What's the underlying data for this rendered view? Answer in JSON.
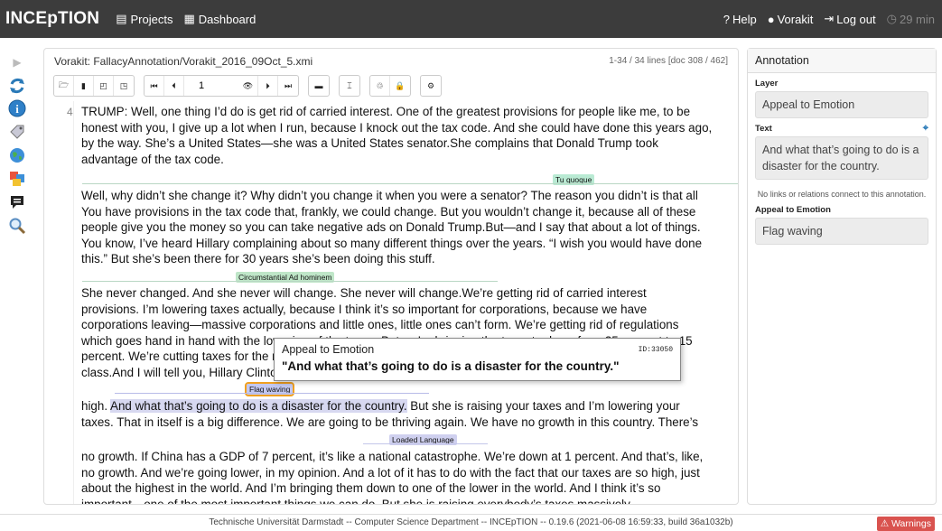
{
  "navbar": {
    "brand": "INCEpTION",
    "projects": "Projects",
    "dashboard": "Dashboard",
    "help": "Help",
    "user": "Vorakit",
    "logout": "Log out",
    "timer": "29 min"
  },
  "document": {
    "title": "Vorakit: FallacyAnnotation/Vorakit_2016_09Oct_5.xmi",
    "position": "1-34 / 34 lines [doc 308 / 462]",
    "page_value": "1",
    "line_number": "4",
    "lines": [
      "TRUMP: Well, one thing I’d do is get rid of carried interest. One of the greatest provisions for people like me, to be",
      "honest with you, I give up a lot when I run, because I knock out the tax code. And she could have done this years ago,",
      "by the way. She’s a United States—she was a United States senator.She complains that Donald Trump took",
      "advantage of the tax code.",
      "Well, why didn’t she change it? Why didn’t you change it when you were a senator? The reason you didn’t is that all",
      "You have provisions in the tax code that, frankly, we could change. But you wouldn’t change it, because all of these",
      "people give you the money so you can take negative ads on Donald Trump.But—and I say that about a lot of things.",
      "You know, I’ve heard Hillary complaining about so many different things over the years. “I wish you would have done",
      "this.” But she’s been there for 30 years she’s been doing this stuff.",
      "She never changed. And she never will change. She never will change.We’re getting rid of carried interest",
      "provisions. I’m lowering taxes actually, because I think it’s so important for corporations, because we have",
      "corporations leaving—massive corporations and little ones, little ones can’t form. We’re getting rid of regulations",
      "which goes hand in hand with the lowering of the taxes. But we’re bringing the tax rate down from 35 percent to 15",
      "percent. We’re cutting taxes for the middle class, and I will tell you we are cutting them big league for the middle",
      "class.And I will tell you, Hillary Clinton is raising your taxes, folks. You can look at me. She’s raising them really",
      "high. ",
      "And what that’s going to do is a disaster for the country.",
      " But she is raising your taxes and I’m lowering your",
      "taxes. That in itself is a big difference. We are going to be thriving again. We have no growth in this country. There’s",
      "no growth. If China has a GDP of 7 percent, it’s like a national catastrophe. We’re down at 1 percent. And that’s, like,",
      "no growth. And we’re going lower, in my opinion. And a lot of it has to do with the fact that our taxes are so high, just",
      "about the highest in the world. And I’m bringing them down to one of the lower in the world. And I think it’s so",
      "important—one of the most important things we can do. But she is raising everybody’s taxes massively."
    ],
    "labels": {
      "tu_quoque": "Tu quoque",
      "circumstantial": "Circumstantial Ad hominem",
      "flag_waving": "Flag waving",
      "loaded_language": "Loaded Language"
    },
    "label_colors": {
      "tu_quoque": "#b9ead3",
      "circumstantial": "#bfe6c8",
      "flag_waving": "#c3c8f0",
      "loaded_language": "#cfd0ef"
    }
  },
  "popup": {
    "title": "Appeal to Emotion",
    "id": "ID:33050",
    "text": "\"And what that’s going to do is a disaster for the country.\""
  },
  "annotation": {
    "header": "Annotation",
    "layer_label": "Layer",
    "layer_value": "Appeal to Emotion",
    "text_label": "Text",
    "text_value": "And what that’s going to do is a disaster for the country.",
    "note": "No links or relations connect to this annotation.",
    "feature_label": "Appeal to Emotion",
    "feature_value": "Flag waving"
  },
  "footer": {
    "text": "Technische Universität Darmstadt -- Computer Science Department -- INCEpTION -- 0.19.6 (2021-06-08 16:59:33, build 36a1032b)",
    "warnings": "Warnings"
  }
}
